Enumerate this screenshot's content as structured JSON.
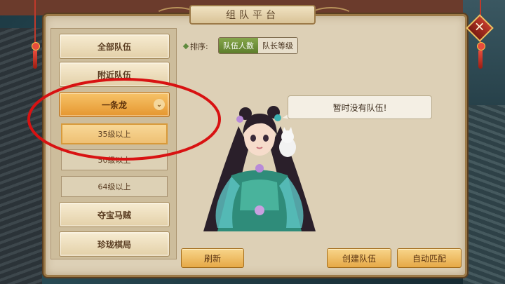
{
  "panel": {
    "title": "组队平台"
  },
  "close": {
    "glyph": "✕"
  },
  "categories": [
    {
      "label": "全部队伍"
    },
    {
      "label": "附近队伍"
    },
    {
      "label": "一条龙",
      "expanded_icon": "⌄"
    },
    {
      "label": "夺宝马贼"
    },
    {
      "label": "珍珑棋局"
    }
  ],
  "subcategories": [
    {
      "label": "35级以上"
    },
    {
      "label": "50级以上"
    },
    {
      "label": "64级以上"
    }
  ],
  "sort": {
    "label": "排序:",
    "options": [
      {
        "label": "队伍人数",
        "active": true
      },
      {
        "label": "队长等级",
        "active": false
      }
    ]
  },
  "empty_message": "暂时没有队伍!",
  "buttons": {
    "refresh": "刷新",
    "create_team": "创建队伍",
    "auto_match": "自动匹配"
  },
  "colors": {
    "accent": "#e5962f",
    "sort_active": "#5d7d2b",
    "frame": "#9c7a48"
  }
}
